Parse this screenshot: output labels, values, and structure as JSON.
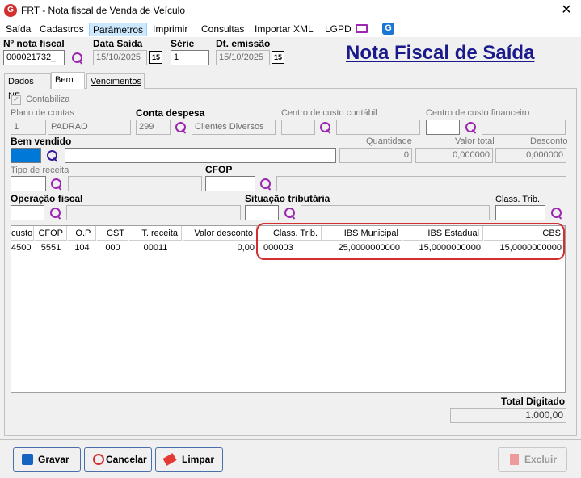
{
  "window": {
    "title": "FRT - Nota fiscal de Venda de Veículo",
    "app_icon": "G"
  },
  "menu": [
    "Saída",
    "Cadastros",
    "Parâmetros",
    "Imprimir",
    "Consultas",
    "Importar XML",
    "LGPD"
  ],
  "header": {
    "nota_label": "Nº nota fiscal",
    "nota_value": "000021732_",
    "data_saida_label": "Data Saída",
    "data_saida_value": "15/10/2025",
    "serie_label": "Série",
    "serie_value": "1",
    "dt_emissao_label": "Dt. emissão",
    "dt_emissao_value": "15/10/2025",
    "page_title": "Nota Fiscal de Saída",
    "cal_glyph": "15"
  },
  "tabs": [
    "Dados NF",
    "Bem",
    "Vencimentos"
  ],
  "form": {
    "contabiliza": "Contabiliza",
    "plano_label": "Plano de contas",
    "plano_code": "1",
    "plano_name": "PADRAO",
    "conta_label": "Conta despesa",
    "conta_code": "299",
    "conta_name": "Clientes Diversos",
    "cc_contabil_label": "Centro de custo contábil",
    "cc_fin_label": "Centro de custo financeiro",
    "bem_label": "Bem vendido",
    "qtd_label": "Quantidade",
    "qtd_value": "0",
    "valor_total_label": "Valor total",
    "valor_total_value": "0,000000",
    "desconto_label": "Desconto",
    "desconto_value": "0,000000",
    "tipo_receita_label": "Tipo de receita",
    "cfop_label": "CFOP",
    "operacao_label": "Operação fiscal",
    "situacao_label": "Situação tributária",
    "class_trib_label": "Class. Trib."
  },
  "grid": {
    "headers": [
      "custo",
      "CFOP",
      "O.P.",
      "CST",
      "T. receita",
      "Valor desconto",
      "Class. Trib.",
      "IBS Municipal",
      "IBS Estadual",
      "CBS"
    ],
    "row": [
      "4500",
      "5551",
      "104",
      "000",
      "00011",
      "0,00",
      "000003",
      "25,0000000000",
      "15,0000000000",
      "15,0000000000"
    ]
  },
  "total": {
    "label": "Total Digitado",
    "value": "1.000,00"
  },
  "buttons": {
    "gravar": "Gravar",
    "cancelar": "Cancelar",
    "limpar": "Limpar",
    "excluir": "Excluir"
  },
  "colors": {
    "title_blue": "#1a1a8c",
    "highlight_red": "#d32f2f",
    "search_purple": "#9c27b0"
  }
}
